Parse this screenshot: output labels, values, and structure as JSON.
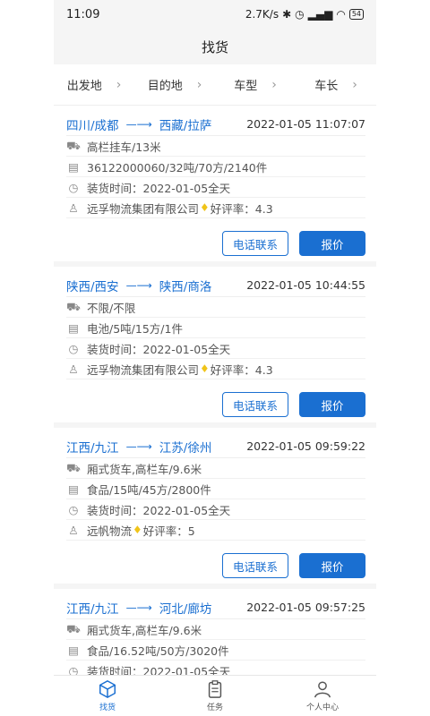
{
  "status": {
    "time": "11:09",
    "speed": "2.7K/s",
    "battery": "54"
  },
  "title": "找货",
  "filters": [
    "出发地",
    "目的地",
    "车型",
    "车长"
  ],
  "cards": [
    {
      "route_from": "四川/成都",
      "route_to": "西藏/拉萨",
      "time": "2022-01-05 11:07:07",
      "truck": "高栏挂车/13米",
      "cargo": "36122000060/32吨/70方/2140件",
      "load": "装货时间：2022-01-05全天",
      "company": "远孚物流集团有限公司",
      "rating": "好评率：4.3",
      "call_label": "电话联系",
      "quote_label": "报价"
    },
    {
      "route_from": "陕西/西安",
      "route_to": "陕西/商洛",
      "time": "2022-01-05 10:44:55",
      "truck": "不限/不限",
      "cargo": "电池/5吨/15方/1件",
      "load": "装货时间：2022-01-05全天",
      "company": "远孚物流集团有限公司",
      "rating": "好评率：4.3",
      "call_label": "电话联系",
      "quote_label": "报价"
    },
    {
      "route_from": "江西/九江",
      "route_to": "江苏/徐州",
      "time": "2022-01-05 09:59:22",
      "truck": "厢式货车,高栏车/9.6米",
      "cargo": "食品/15吨/45方/2800件",
      "load": "装货时间：2022-01-05全天",
      "company": "远帆物流",
      "rating": "好评率：5",
      "call_label": "电话联系",
      "quote_label": "报价"
    },
    {
      "route_from": "江西/九江",
      "route_to": "河北/廊坊",
      "time": "2022-01-05 09:57:25",
      "truck": "厢式货车,高栏车/9.6米",
      "cargo": "食品/16.52吨/50方/3020件",
      "load": "装货时间：2022-01-05全天",
      "company": "",
      "rating": "",
      "call_label": "",
      "quote_label": ""
    }
  ],
  "tabs": [
    "找货",
    "任务",
    "个人中心"
  ],
  "colors": {
    "accent": "#1a6fd1",
    "rating_icon": "#f0c419"
  }
}
